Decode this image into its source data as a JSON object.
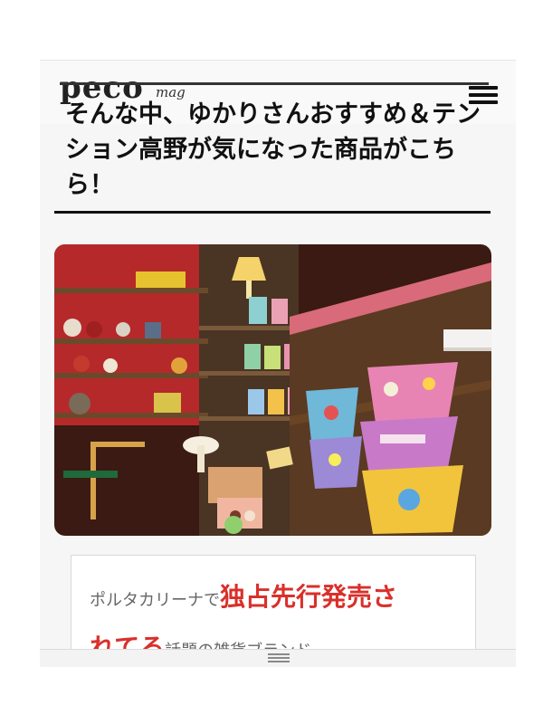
{
  "header": {
    "logo": "peco",
    "logo_sub": "mag"
  },
  "article": {
    "title": "そんな中、ゆかりさんおすすめ＆テンション高野が気になった商品がこちら！"
  },
  "card": {
    "prefix": "ポルタカリーナで",
    "highlight_1": "独占先行発売さ",
    "highlight_2": "れてる",
    "suffix": "話題の雑貨ブランド"
  },
  "colors": {
    "accent": "#d9302b",
    "text": "#111111"
  },
  "icons": {
    "menu": "hamburger-menu-icon",
    "bottom_handle": "drag-handle-icon"
  }
}
